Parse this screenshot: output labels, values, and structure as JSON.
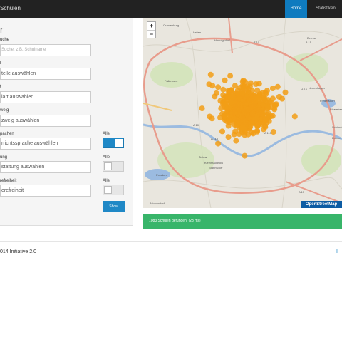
{
  "navbar": {
    "brand": "Schulen",
    "home": "Home",
    "stats": "Statistiken"
  },
  "panel": {
    "title": "r",
    "fields": [
      {
        "label": "uche",
        "value": "Suche, z.B. Schulname",
        "placeholder": true
      },
      {
        "label": "l",
        "value": "teile auswählen"
      },
      {
        "label": "t",
        "value": "lart auswählen"
      },
      {
        "label": "weig",
        "value": "zweig auswählen"
      },
      {
        "label": "pachen",
        "value": "rrichtssprache auswählen",
        "alle": "Alle",
        "toggle": "on"
      },
      {
        "label": "ung",
        "value": "stattung auswählen",
        "alle": "Alle",
        "toggle": "off"
      },
      {
        "label": "refreiheit",
        "value": "erefreiheit",
        "alle": "Alle",
        "toggle": "off"
      }
    ],
    "show_button": "Show"
  },
  "map": {
    "zoom_in": "+",
    "zoom_out": "−",
    "attribution": "OpenStreetMap",
    "labels": [
      "Oranienburg",
      "Velten",
      "Hennigsdorf",
      "Falkensee",
      "Potsdam",
      "Teltow",
      "Kleinmachnow",
      "Stahnsdorf",
      "Michendorf",
      "Bernau",
      "Strausberg",
      "Erkner",
      "Schöneiche",
      "Neuenhagen",
      "Fredersdorf",
      "A 10",
      "A 11",
      "A 115",
      "A 113",
      "A 10",
      "A 13",
      "A 10"
    ],
    "marker_color": "#f29d16"
  },
  "result": "1083 Schulen gefunden. (23 ms)",
  "footer": {
    "text": "014 Initiative 2.0",
    "link": "I"
  }
}
